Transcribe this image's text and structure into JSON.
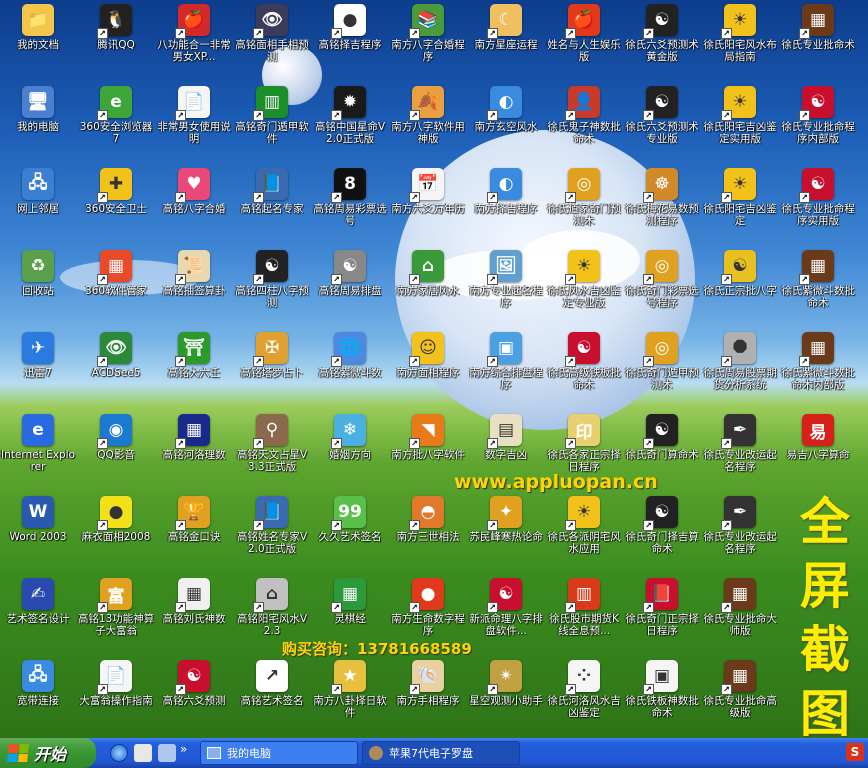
{
  "desktop": {
    "icons": [
      {
        "label": "我的文档",
        "icon": "folder-documents-icon",
        "color": "#f3c54a",
        "glyph": "📁",
        "shortcut": false
      },
      {
        "label": "腾讯QQ",
        "icon": "qq-penguin-icon",
        "color": "#222222",
        "glyph": "🐧",
        "shortcut": true
      },
      {
        "label": "八功能合一非常男女XP...",
        "icon": "apple-icon",
        "color": "#d22a2a",
        "glyph": "🍎",
        "shortcut": true
      },
      {
        "label": "高铭面相手相预测",
        "icon": "eye-icon",
        "color": "#3b3b5a",
        "glyph": "👁",
        "shortcut": true
      },
      {
        "label": "高铭择吉程序",
        "icon": "red-dot-icon",
        "color": "#ffffff",
        "glyph": "●",
        "shortcut": true
      },
      {
        "label": "南方八字合婚程序",
        "icon": "book-stack-icon",
        "color": "#4a9c3a",
        "glyph": "📚",
        "shortcut": true
      },
      {
        "label": "南方星座运程",
        "icon": "zodiac-icon",
        "color": "#f0c060",
        "glyph": "☾",
        "shortcut": true
      },
      {
        "label": "姓名与人生娱乐版",
        "icon": "apple-red-icon",
        "color": "#e03a1a",
        "glyph": "🍎",
        "shortcut": true
      },
      {
        "label": "徐氏六爻预测术黄金版",
        "icon": "yin-yang-icon",
        "color": "#222222",
        "glyph": "☯",
        "shortcut": true
      },
      {
        "label": "徐氏阳宅风水布局指南",
        "icon": "sun-icon",
        "color": "#f2c21b",
        "glyph": "☀",
        "shortcut": true
      },
      {
        "label": "徐氏专业批命术",
        "icon": "abacus-icon",
        "color": "#6a3a1a",
        "glyph": "▦",
        "shortcut": true
      },
      {
        "label": "我的电脑",
        "icon": "my-computer-icon",
        "color": "#4b7fd0",
        "glyph": "🖥",
        "shortcut": false
      },
      {
        "label": "360安全浏览器7",
        "icon": "browser-360-icon",
        "color": "#3da53a",
        "glyph": "e",
        "shortcut": true
      },
      {
        "label": "非常男女使用说明",
        "icon": "document-icon",
        "color": "#f5f5f5",
        "glyph": "📄",
        "shortcut": true
      },
      {
        "label": "高铭奇门遁甲软件",
        "icon": "bars-icon",
        "color": "#1a8f2a",
        "glyph": "▥",
        "shortcut": true
      },
      {
        "label": "高铭中国星命V2.0正式版",
        "icon": "starburst-icon",
        "color": "#1a1a1a",
        "glyph": "✹",
        "shortcut": true
      },
      {
        "label": "南方八字软件用神版",
        "icon": "leaf-icon",
        "color": "#e8a040",
        "glyph": "🍂",
        "shortcut": true
      },
      {
        "label": "南方玄空风水",
        "icon": "globe-icon",
        "color": "#3a8ae0",
        "glyph": "◐",
        "shortcut": true
      },
      {
        "label": "徐氏鬼子神数批命术",
        "icon": "person-icon",
        "color": "#c83a2a",
        "glyph": "👤",
        "shortcut": true
      },
      {
        "label": "徐氏六爻预测术专业版",
        "icon": "yin-yang-icon",
        "color": "#222222",
        "glyph": "☯",
        "shortcut": true
      },
      {
        "label": "徐氏阳宅吉凶鉴定实用版",
        "icon": "sun-icon",
        "color": "#f2c21b",
        "glyph": "☀",
        "shortcut": true
      },
      {
        "label": "徐氏专业批命程序内部版",
        "icon": "taiji-red-icon",
        "color": "#c8102e",
        "glyph": "☯",
        "shortcut": true
      },
      {
        "label": "网上邻居",
        "icon": "network-icon",
        "color": "#3b7fd4",
        "glyph": "🖧",
        "shortcut": false
      },
      {
        "label": "360安全卫士",
        "icon": "shield-360-icon",
        "color": "#f2c21b",
        "glyph": "✚",
        "shortcut": true
      },
      {
        "label": "高铭八字合婚",
        "icon": "heart-icon",
        "color": "#e8487a",
        "glyph": "♥",
        "shortcut": true
      },
      {
        "label": "高铭起名专家",
        "icon": "books-icon",
        "color": "#3a6ab0",
        "glyph": "📘",
        "shortcut": true
      },
      {
        "label": "高铭周易彩票选号",
        "icon": "eight-ball-icon",
        "color": "#111111",
        "glyph": "8",
        "shortcut": true
      },
      {
        "label": "南方六爻万年历",
        "icon": "calendar-icon",
        "color": "#f5f5f5",
        "glyph": "📅",
        "shortcut": true
      },
      {
        "label": "南方择吉程序",
        "icon": "globe-icon",
        "color": "#3a8ae0",
        "glyph": "◐",
        "shortcut": true
      },
      {
        "label": "徐氏道家奇门预测术",
        "icon": "coin-icon",
        "color": "#e0a020",
        "glyph": "◎",
        "shortcut": true
      },
      {
        "label": "徐氏梅花易数预测程序",
        "icon": "buddha-icon",
        "color": "#d08a2a",
        "glyph": "☸",
        "shortcut": true
      },
      {
        "label": "徐氏阳宅吉凶鉴定",
        "icon": "sun-icon",
        "color": "#f2c21b",
        "glyph": "☀",
        "shortcut": true
      },
      {
        "label": "徐氏专业批命程序实用版",
        "icon": "taiji-red-icon",
        "color": "#c8102e",
        "glyph": "☯",
        "shortcut": true
      },
      {
        "label": "回收站",
        "icon": "recycle-bin-icon",
        "color": "#5aa04a",
        "glyph": "♻",
        "shortcut": false
      },
      {
        "label": "360软件管家",
        "icon": "apps-360-icon",
        "color": "#e84a2a",
        "glyph": "▦",
        "shortcut": true
      },
      {
        "label": "高铭抽签算卦",
        "icon": "scroll-icon",
        "color": "#e8d8b0",
        "glyph": "📜",
        "shortcut": true
      },
      {
        "label": "高铭四柱八字预测",
        "icon": "yin-yang-icon",
        "color": "#222222",
        "glyph": "☯",
        "shortcut": true
      },
      {
        "label": "高铭周易排盘",
        "icon": "yin-yang-gray-icon",
        "color": "#888888",
        "glyph": "☯",
        "shortcut": true
      },
      {
        "label": "南方家居风水",
        "icon": "house-icon",
        "color": "#3a9a3a",
        "glyph": "⌂",
        "shortcut": true
      },
      {
        "label": "南方专业起名程序",
        "icon": "picture-icon",
        "color": "#60a0d0",
        "glyph": "🖼",
        "shortcut": true
      },
      {
        "label": "徐氏风水吉凶鉴定专业版",
        "icon": "sun-icon",
        "color": "#f2c21b",
        "glyph": "☀",
        "shortcut": true
      },
      {
        "label": "徐氏奇门彩票选号程序",
        "icon": "coin-icon",
        "color": "#e0a020",
        "glyph": "◎",
        "shortcut": true
      },
      {
        "label": "徐氏正宗批八字",
        "icon": "yin-yang-gold-icon",
        "color": "#e8c020",
        "glyph": "☯",
        "shortcut": true
      },
      {
        "label": "徐氏紫微斗数批命术",
        "icon": "abacus-icon",
        "color": "#6a3a1a",
        "glyph": "▦",
        "shortcut": true
      },
      {
        "label": "迅雷7",
        "icon": "thunder-bird-icon",
        "color": "#2a7ae0",
        "glyph": "✈",
        "shortcut": false
      },
      {
        "label": "ACDSee5",
        "icon": "eye-green-icon",
        "color": "#2a8a3a",
        "glyph": "👁",
        "shortcut": true
      },
      {
        "label": "高铭大六壬",
        "icon": "pagoda-icon",
        "color": "#2a9a2a",
        "glyph": "⛩",
        "shortcut": true
      },
      {
        "label": "高铭塔罗占卜",
        "icon": "cross-icon",
        "color": "#e0a030",
        "glyph": "✠",
        "shortcut": true
      },
      {
        "label": "高铭紫微斗数",
        "icon": "globe-star-icon",
        "color": "#4a8ae0",
        "glyph": "🌐",
        "shortcut": true
      },
      {
        "label": "南方面相程序",
        "icon": "smiley-face-icon",
        "color": "#f2c21b",
        "glyph": "☺",
        "shortcut": true
      },
      {
        "label": "南方综合排盘程序",
        "icon": "cube-icon",
        "color": "#4aa0e0",
        "glyph": "▣",
        "shortcut": true
      },
      {
        "label": "徐氏高级铁板批命术",
        "icon": "taiji-red-icon",
        "color": "#c8102e",
        "glyph": "☯",
        "shortcut": true
      },
      {
        "label": "徐氏奇门遁甲预测术",
        "icon": "coin-icon",
        "color": "#e0a020",
        "glyph": "◎",
        "shortcut": true
      },
      {
        "label": "徐氏周易股票期货分析系统",
        "icon": "octagon-icon",
        "color": "#b0b0b0",
        "glyph": "⯃",
        "shortcut": true
      },
      {
        "label": "徐氏紫微斗数批命术内部版",
        "icon": "abacus-icon",
        "color": "#6a3a1a",
        "glyph": "▦",
        "shortcut": true
      },
      {
        "label": "Internet Explorer",
        "icon": "ie-icon",
        "color": "#2a6ae0",
        "glyph": "e",
        "shortcut": false
      },
      {
        "label": "QQ影音",
        "icon": "film-reel-icon",
        "color": "#1a7ad0",
        "glyph": "◉",
        "shortcut": true
      },
      {
        "label": "高铭河洛理数",
        "icon": "grid-dots-icon",
        "color": "#1a2a8a",
        "glyph": "▦",
        "shortcut": true
      },
      {
        "label": "高铭天文占星V3.3正式版",
        "icon": "telescope-icon",
        "color": "#8a6a4a",
        "glyph": "⚲",
        "shortcut": true
      },
      {
        "label": "婚姻方向",
        "icon": "snowflake-icon",
        "color": "#4ab0e0",
        "glyph": "❄",
        "shortcut": true
      },
      {
        "label": "南方批八字软件",
        "icon": "rss-icon",
        "color": "#e87a1a",
        "glyph": "◥",
        "shortcut": true
      },
      {
        "label": "数字吉凶",
        "icon": "calculator-icon",
        "color": "#e8e0c0",
        "glyph": "▤",
        "shortcut": true
      },
      {
        "label": "徐氏各家正宗择日程序",
        "icon": "seal-icon",
        "color": "#e8d070",
        "glyph": "印",
        "shortcut": true
      },
      {
        "label": "徐氏奇门算命术",
        "icon": "yin-yang-icon",
        "color": "#222222",
        "glyph": "☯",
        "shortcut": true
      },
      {
        "label": "徐氏专业改运起名程序",
        "icon": "pen-icon",
        "color": "#333333",
        "glyph": "✒",
        "shortcut": true
      },
      {
        "label": "易吉八字算命",
        "icon": "yi-character-icon",
        "color": "#d8201a",
        "glyph": "易",
        "shortcut": false
      },
      {
        "label": "Word 2003",
        "icon": "word-icon",
        "color": "#2a5ab0",
        "glyph": "W",
        "shortcut": false
      },
      {
        "label": "麻衣面相2008",
        "icon": "yellow-circle-icon",
        "color": "#f2e01b",
        "glyph": "●",
        "shortcut": true
      },
      {
        "label": "高铭金口诀",
        "icon": "trophy-icon",
        "color": "#e0a020",
        "glyph": "🏆",
        "shortcut": true
      },
      {
        "label": "高铭姓名专家V2.0正式版",
        "icon": "books-icon",
        "color": "#3a6ab0",
        "glyph": "📘",
        "shortcut": true
      },
      {
        "label": "久久艺术签名",
        "icon": "ninety-nine-icon",
        "color": "#5ac04a",
        "glyph": "99",
        "shortcut": true
      },
      {
        "label": "南方三世相法",
        "icon": "fan-icon",
        "color": "#e07a2a",
        "glyph": "◓",
        "shortcut": true
      },
      {
        "label": "苏民峰寒热论命",
        "icon": "bird-icon",
        "color": "#e0a020",
        "glyph": "✦",
        "shortcut": true
      },
      {
        "label": "徐氏各派阴宅风水应用",
        "icon": "sun-icon",
        "color": "#f2c21b",
        "glyph": "☀",
        "shortcut": true
      },
      {
        "label": "徐氏奇门择吉算命术",
        "icon": "yin-yang-icon",
        "color": "#222222",
        "glyph": "☯",
        "shortcut": true
      },
      {
        "label": "徐氏专业改运起名程序",
        "icon": "pen-icon",
        "color": "#333333",
        "glyph": "✒",
        "shortcut": true
      },
      {
        "label": "艺术签名设计",
        "icon": "signature-icon",
        "color": "#2a4ab0",
        "glyph": "✍",
        "shortcut": false
      },
      {
        "label": "高铭13功能神算子大富翁",
        "icon": "rich-man-icon",
        "color": "#e0a020",
        "glyph": "富",
        "shortcut": true
      },
      {
        "label": "高铭刘氏神数",
        "icon": "number-grid-icon",
        "color": "#f0f0f0",
        "glyph": "▦",
        "shortcut": true
      },
      {
        "label": "高铭阳宅风水V2.3",
        "icon": "building-icon",
        "color": "#c0c0c0",
        "glyph": "⌂",
        "shortcut": true
      },
      {
        "label": "灵棋经",
        "icon": "checker-icon",
        "color": "#2a9a3a",
        "glyph": "▦",
        "shortcut": true
      },
      {
        "label": "南方生命数字程序",
        "icon": "tomato-icon",
        "color": "#e03a1a",
        "glyph": "●",
        "shortcut": true
      },
      {
        "label": "新派命理八字排盘软件...",
        "icon": "taiji-red-icon",
        "color": "#c8102e",
        "glyph": "☯",
        "shortcut": true
      },
      {
        "label": "徐氏股市期货K线全息预...",
        "icon": "chart-bars-icon",
        "color": "#d83a1a",
        "glyph": "▥",
        "shortcut": true
      },
      {
        "label": "徐氏奇门正宗择日程序",
        "icon": "book-red-icon",
        "color": "#c8102e",
        "glyph": "📕",
        "shortcut": true
      },
      {
        "label": "徐氏专业批命大师版",
        "icon": "abacus-icon",
        "color": "#6a3a1a",
        "glyph": "▦",
        "shortcut": true
      },
      {
        "label": "宽带连接",
        "icon": "broadband-icon",
        "color": "#3a8ae0",
        "glyph": "🖧",
        "shortcut": false
      },
      {
        "label": "大富翁操作指南",
        "icon": "document-icon",
        "color": "#f5f5f5",
        "glyph": "📄",
        "shortcut": true
      },
      {
        "label": "高铭六爻预测",
        "icon": "taiji-red-icon",
        "color": "#c8102e",
        "glyph": "☯",
        "shortcut": true
      },
      {
        "label": "高铭艺术签名",
        "icon": "shortcut-icon",
        "color": "#ffffff",
        "glyph": "↗",
        "shortcut": false
      },
      {
        "label": "南方八卦择日软件",
        "icon": "star-icon",
        "color": "#e8c040",
        "glyph": "★",
        "shortcut": true
      },
      {
        "label": "南方手相程序",
        "icon": "shell-icon",
        "color": "#e8d0a0",
        "glyph": "🐚",
        "shortcut": true
      },
      {
        "label": "星空观测小助手",
        "icon": "satellite-icon",
        "color": "#c0a040",
        "glyph": "✴",
        "shortcut": true
      },
      {
        "label": "徐氏河洛风水吉凶鉴定",
        "icon": "hetu-icon",
        "color": "#f5f5f5",
        "glyph": "⁘",
        "shortcut": true
      },
      {
        "label": "徐氏铁板神数批命术",
        "icon": "map-icon",
        "color": "#f5f5f5",
        "glyph": "▣",
        "shortcut": true
      },
      {
        "label": "徐氏专业批命高级版",
        "icon": "abacus-icon",
        "color": "#6a3a1a",
        "glyph": "▦",
        "shortcut": true
      }
    ],
    "url_text": "www.appluopan.cn",
    "contact_text": "购买咨询：13781668589",
    "side_text": [
      "全",
      "屏",
      "截",
      "图"
    ]
  },
  "taskbar": {
    "start_label": "开始",
    "quick_launch": [
      "ie-icon",
      "desktop-icon",
      "show-desktop-icon"
    ],
    "expand_glyph": "»",
    "tasks": [
      {
        "label": "我的电脑",
        "icon": "my-computer-icon"
      },
      {
        "label": "苹果7代电子罗盘",
        "icon": "compass-icon"
      }
    ],
    "tray_label": "S",
    "tray_icon": "ime-icon"
  },
  "colors": {
    "accent_text": "#ffd400",
    "taskbar": "#245edb",
    "start": "#3c9a35"
  }
}
